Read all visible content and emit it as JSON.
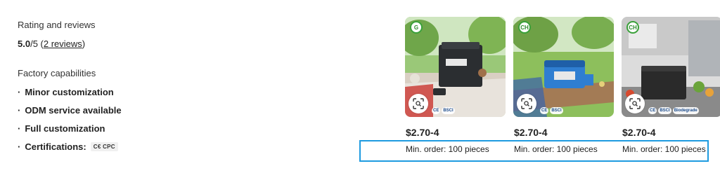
{
  "rating": {
    "heading": "Rating and reviews",
    "score": "5.0",
    "out_of": "/5 (",
    "reviews_link": "2 reviews",
    "close_paren": ")"
  },
  "capabilities": {
    "heading": "Factory capabilities",
    "items": [
      {
        "bullet": "·",
        "label": "Minor customization"
      },
      {
        "bullet": "·",
        "label": "ODM service available"
      },
      {
        "bullet": "·",
        "label": "Full customization"
      },
      {
        "bullet": "·",
        "label": "Certifications:"
      }
    ],
    "cert_badge": "C€ CPC"
  },
  "products": [
    {
      "price": "$2.70-4",
      "moq": "Min. order: 100 pieces",
      "logo": "G",
      "certs": [
        "BSCI"
      ],
      "icon": "search-image-icon"
    },
    {
      "price": "$2.70-4",
      "moq": "Min. order: 100 pieces",
      "logo": "CH",
      "certs": [
        "BSCI"
      ],
      "icon": "search-image-icon"
    },
    {
      "price": "$2.70-4",
      "moq": "Min. order: 100 pieces",
      "logo": "CH",
      "certs": [
        "BSCI",
        "Biodegrade"
      ],
      "icon": "search-image-icon"
    }
  ],
  "colors": {
    "highlight": "#1e9be0",
    "text": "#222222"
  }
}
